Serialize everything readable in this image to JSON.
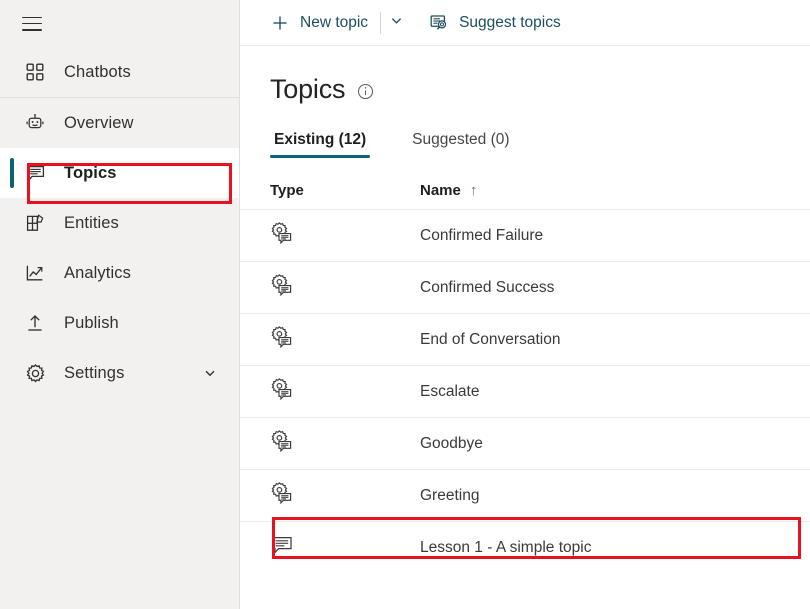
{
  "colors": {
    "accent": "#0d6375",
    "command_text": "#1b4f5e",
    "annotation": "#e81123",
    "sidebar_bg": "#f2f1f0",
    "row_border": "#edebe9"
  },
  "sidebar": {
    "menu_toggle_name": "hamburger-menu",
    "items": [
      {
        "id": "chatbots",
        "label": "Chatbots",
        "icon": "grid-icon",
        "selected": false,
        "chevron": false
      },
      {
        "id": "overview",
        "label": "Overview",
        "icon": "bot-icon",
        "selected": false,
        "chevron": false
      },
      {
        "id": "topics",
        "label": "Topics",
        "icon": "chat-bubble-icon",
        "selected": true,
        "chevron": false
      },
      {
        "id": "entities",
        "label": "Entities",
        "icon": "entities-grid-icon",
        "selected": false,
        "chevron": false
      },
      {
        "id": "analytics",
        "label": "Analytics",
        "icon": "line-chart-icon",
        "selected": false,
        "chevron": false
      },
      {
        "id": "publish",
        "label": "Publish",
        "icon": "upload-icon",
        "selected": false,
        "chevron": false
      },
      {
        "id": "settings",
        "label": "Settings",
        "icon": "gear-icon",
        "selected": false,
        "chevron": true
      }
    ]
  },
  "command_bar": {
    "new_topic_label": "New topic",
    "new_topic_icon": "plus-icon",
    "split_icon": "chevron-down-icon",
    "suggest_topics_label": "Suggest topics",
    "suggest_topics_icon": "suggest-topics-icon"
  },
  "page": {
    "title": "Topics",
    "info_icon": "info-icon"
  },
  "tabs": [
    {
      "id": "existing",
      "label": "Existing (12)",
      "active": true
    },
    {
      "id": "suggested",
      "label": "Suggested (0)",
      "active": false
    }
  ],
  "table": {
    "columns": [
      {
        "id": "type",
        "label": "Type",
        "sorted": false
      },
      {
        "id": "name",
        "label": "Name",
        "sorted": true,
        "sort_direction": "↑"
      }
    ],
    "rows": [
      {
        "type_icon": "system-topic-icon",
        "name": "Confirmed Failure",
        "highlighted": false
      },
      {
        "type_icon": "system-topic-icon",
        "name": "Confirmed Success",
        "highlighted": false
      },
      {
        "type_icon": "system-topic-icon",
        "name": "End of Conversation",
        "highlighted": false
      },
      {
        "type_icon": "system-topic-icon",
        "name": "Escalate",
        "highlighted": false
      },
      {
        "type_icon": "system-topic-icon",
        "name": "Goodbye",
        "highlighted": false
      },
      {
        "type_icon": "system-topic-icon",
        "name": "Greeting",
        "highlighted": true
      },
      {
        "type_icon": "custom-topic-icon",
        "name": "Lesson 1 - A simple topic",
        "highlighted": false
      }
    ]
  },
  "annotations": [
    {
      "id": "annot-topics",
      "target": "sidebar-item-topics"
    },
    {
      "id": "annot-greeting",
      "target": "table-row-greeting"
    }
  ]
}
